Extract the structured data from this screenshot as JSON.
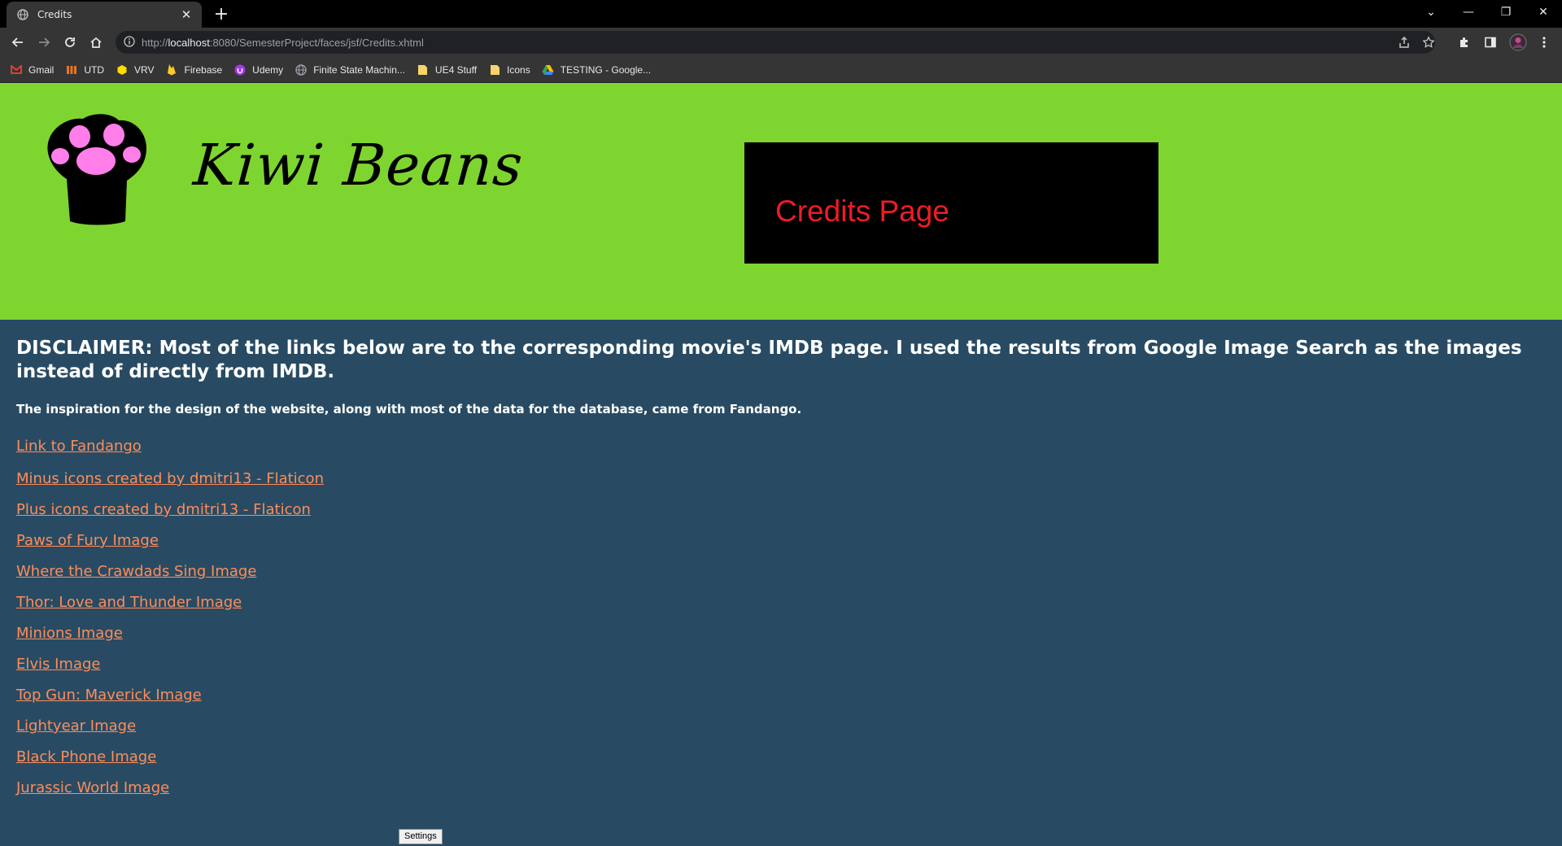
{
  "browser": {
    "tab": {
      "title": "Credits",
      "close_glyph": "✕"
    },
    "new_tab_glyph": "+",
    "window": {
      "dropdown_glyph": "⌄",
      "minimize_glyph": "—",
      "restore_glyph": "❐",
      "close_glyph": "✕"
    },
    "url": {
      "scheme": "http://",
      "host": "localhost",
      "path": ":8080/SemesterProject/faces/jsf/Credits.xhtml"
    },
    "bookmarks": [
      {
        "label": "Gmail",
        "icon": "gmail-icon",
        "color": "#ea4335"
      },
      {
        "label": "UTD",
        "icon": "utd-icon",
        "color": "#e87722"
      },
      {
        "label": "VRV",
        "icon": "vrv-icon",
        "color": "#ffdd00"
      },
      {
        "label": "Firebase",
        "icon": "firebase-icon",
        "color": "#ffca28"
      },
      {
        "label": "Udemy",
        "icon": "udemy-icon",
        "color": "#a435f0"
      },
      {
        "label": "Finite State Machin...",
        "icon": "globe-icon",
        "color": "#9aa0a6"
      },
      {
        "label": "UE4 Stuff",
        "icon": "folder-icon",
        "color": "#f6d36b"
      },
      {
        "label": "Icons",
        "icon": "folder-icon",
        "color": "#f6d36b"
      },
      {
        "label": "TESTING - Google...",
        "icon": "drive-icon",
        "color": "#34a853"
      }
    ]
  },
  "header": {
    "brand": "Kiwi Beans",
    "page_title": "Credits Page",
    "colors": {
      "background": "#7ed52f",
      "title_box": "#000000",
      "title_text": "#ee1c25",
      "paw": "#000000",
      "paw_pads": "#ff7eea"
    }
  },
  "content": {
    "disclaimer": "DISCLAIMER: Most of the links below are to the corresponding movie's IMDB page. I used the results from Google Image Search as the images instead of directly from IMDB.",
    "inspiration": "The inspiration for the design of the website, along with most of the data for the database, came from Fandango.",
    "links": [
      "Link to Fandango",
      "Minus icons created by dmitri13 - Flaticon",
      "Plus icons created by dmitri13 - Flaticon",
      "Paws of Fury Image",
      "Where the Crawdads Sing Image",
      "Thor: Love and Thunder Image",
      "Minions Image",
      "Elvis Image",
      "Top Gun: Maverick Image",
      "Lightyear Image",
      "Black Phone Image",
      "Jurassic World Image"
    ],
    "colors": {
      "background": "#284b63",
      "link": "#ff8c5a",
      "text": "#ffffff"
    }
  },
  "settings_button": "Settings"
}
